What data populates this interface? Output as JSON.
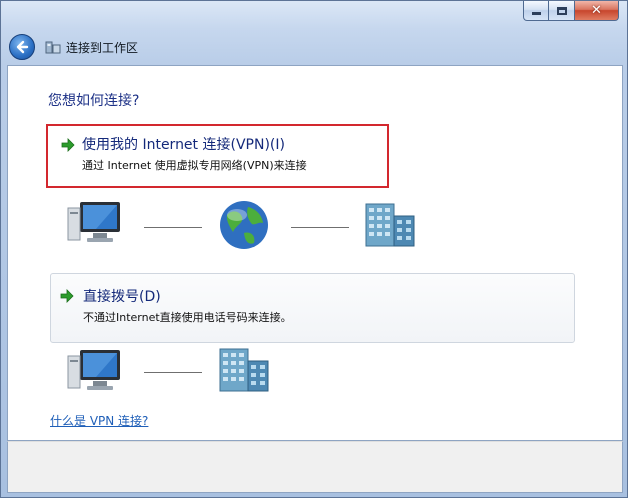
{
  "window": {
    "caption": {
      "minimize_icon": "minimize-icon",
      "maximize_icon": "maximize-icon",
      "close_glyph": "✕"
    }
  },
  "nav": {
    "back_icon": "back-arrow-icon",
    "app_icon": "network-connection-icon",
    "title": "连接到工作区"
  },
  "main": {
    "question": "您想如何连接?",
    "options": [
      {
        "title": "使用我的 Internet 连接(VPN)(I)",
        "description": "通过 Internet 使用虚拟专用网络(VPN)来连接",
        "icon": "green-arrow-icon",
        "highlight_color": "#d3282e",
        "diagram": [
          "computer-icon",
          "globe-icon",
          "office-building-icon"
        ]
      },
      {
        "title": "直接拨号(D)",
        "description": "不通过Internet直接使用电话号码来连接。",
        "icon": "green-arrow-icon",
        "diagram": [
          "computer-icon",
          "office-building-icon"
        ]
      }
    ],
    "help_link": "什么是 VPN 连接?"
  },
  "colors": {
    "title_blue": "#14297a",
    "link_blue": "#1f5fb8",
    "arrow_green": "#2c9c2c"
  }
}
